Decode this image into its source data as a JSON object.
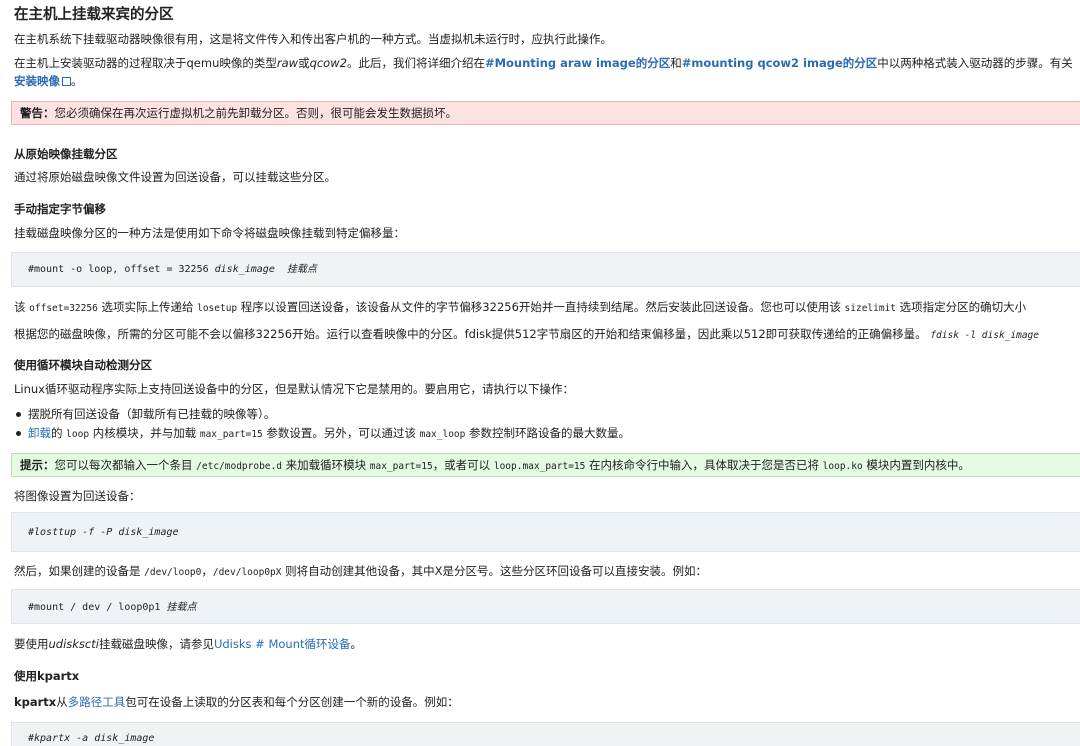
{
  "title": "在主机上挂载来宾的分区",
  "intro1": "在主机系统下挂载驱动器映像很有用，这是将文件传入和传出客户机的一种方式。当虚拟机未运行时，应执行此操作。",
  "intro2": {
    "a": "在主机上安装驱动器的过程取决于qemu映像的类型",
    "raw": "raw",
    "or": "或",
    "qcow2": "qcow2",
    "b": "。此后，我们将详细介绍在",
    "link1": "#Mounting araw image的分区",
    "and": "和",
    "link2": "#mounting qcow2 image的分区",
    "c": "中以两种格式装入驱动器的步骤。有关",
    "link3": "安装映像",
    "d": "。"
  },
  "warning": {
    "label": "警告：",
    "text": "您必须确保在再次运行虚拟机之前先卸载分区。否则，很可能会发生数据损坏。"
  },
  "sec1": {
    "heading": "从原始映像挂载分区",
    "text": "通过将原始磁盘映像文件设置为回送设备，可以挂载这些分区。"
  },
  "sec2": {
    "heading": "手动指定字节偏移",
    "text": "挂载磁盘映像分区的一种方法是使用如下命令将磁盘映像挂载到特定偏移量：",
    "cmd_a": "#mount -o loop, offset = 32256 ",
    "cmd_img": "disk_image",
    "cmd_mp": "挂载点",
    "p1_a": "该 ",
    "p1_code1": "offset=32256",
    "p1_b": " 选项实际上传递给 ",
    "p1_code2": "losetup",
    "p1_c": " 程序以设置回送设备，该设备从文件的字节偏移32256开始并一直持续到结尾。然后安装此回送设备。您也可以使用该 ",
    "p1_code3": "sizelimit",
    "p1_d": " 选项指定分区的确切大小",
    "p2_a": "根据您的磁盘映像，所需的分区可能不会以偏移32256开始。运行以查看映像中的分区。fdisk提供512字节扇区的开始和结束偏移量，因此乘以512即可获取传递给的正确偏移量。",
    "p2_code": "fdisk -l disk_image"
  },
  "sec3": {
    "heading": "使用循环模块自动检测分区",
    "text": "Linux循环驱动程序实际上支持回送设备中的分区，但是默认情况下它是禁用的。要启用它，请执行以下操作：",
    "li1": "摆脱所有回送设备（卸载所有已挂载的映像等）。",
    "li2_link": "卸载",
    "li2_a": "的 ",
    "li2_code1": "loop",
    "li2_b": " 内核模块，并与加载 ",
    "li2_code2": "max_part=15",
    "li2_c": " 参数设置。另外，可以通过该 ",
    "li2_code3": "max_loop",
    "li2_d": " 参数控制环路设备的最大数量。",
    "tip_label": "提示：",
    "tip_a": "您可以每次都输入一个条目 ",
    "tip_code1": "/etc/modprobe.d",
    "tip_b": " 来加载循环模块 ",
    "tip_code2": "max_part=15",
    "tip_c": "，或者可以 ",
    "tip_code3": "loop.max_part=15",
    "tip_d": " 在内核命令行中输入，具体取决于您是否已将 ",
    "tip_code4": "loop.ko",
    "tip_e": " 模块内置到内核中。",
    "set_text": "将图像设置为回送设备：",
    "cmd2_a": "#losttup -f -P ",
    "cmd2_img": "disk_image",
    "then_a": "然后，如果创建的设备是 ",
    "then_code1": "/dev/loop0",
    "then_b": "，",
    "then_code2": "/dev/loop0pX",
    "then_c": " 则将自动创建其他设备，其中X是分区号。这些分区环回设备可以直接安装。例如：",
    "cmd3_a": "#mount / dev / loop0p1 ",
    "cmd3_mp": "挂载点",
    "udisks_a": "要使用",
    "udisks_em": "udiskscti",
    "udisks_b": "挂载磁盘映像，请参见",
    "udisks_link": "Udisks # Mount循环设备",
    "udisks_c": "。"
  },
  "sec4": {
    "heading": "使用kpartx",
    "bold": "kpartx",
    "a": "从",
    "link": "多路径工具",
    "b": "包可在设备上读取的分区表和每个分区创建一个新的设备。例如：",
    "cmd_a": "#kpartx -a ",
    "cmd_img": "disk_image"
  }
}
